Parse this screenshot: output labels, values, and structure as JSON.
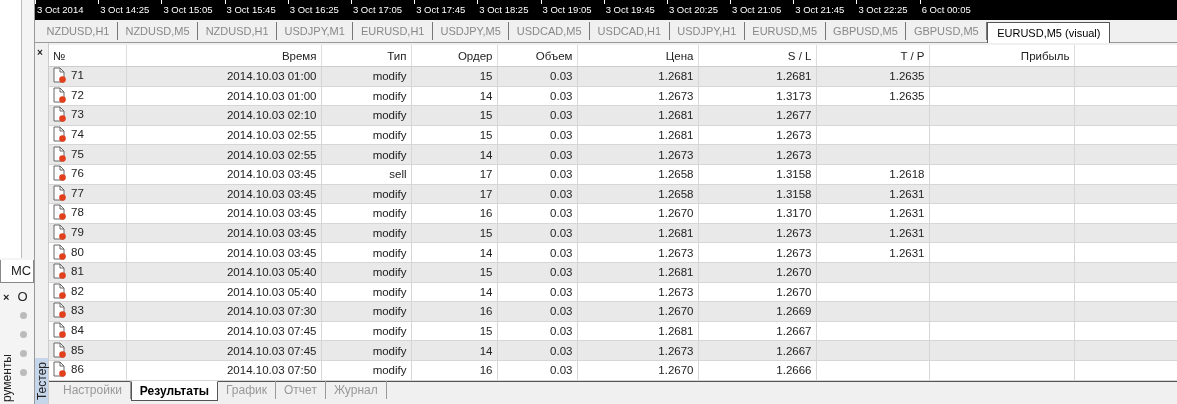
{
  "time_axis": [
    "3 Oct 2014",
    "3 Oct 14:25",
    "3 Oct 15:05",
    "3 Oct 15:45",
    "3 Oct 16:25",
    "3 Oct 17:05",
    "3 Oct 17:45",
    "3 Oct 18:25",
    "3 Oct 19:05",
    "3 Oct 19:45",
    "3 Oct 20:25",
    "3 Oct 21:05",
    "3 Oct 21:45",
    "3 Oct 22:25",
    "6 Oct 00:05"
  ],
  "chart_tabs": [
    {
      "label": "NZDUSD,H1",
      "selected": false
    },
    {
      "label": "NZDUSD,M5",
      "selected": false
    },
    {
      "label": "NZDUSD,H1",
      "selected": false
    },
    {
      "label": "USDJPY,M1",
      "selected": false
    },
    {
      "label": "EURUSD,H1",
      "selected": false
    },
    {
      "label": "USDJPY,M5",
      "selected": false
    },
    {
      "label": "USDCAD,M5",
      "selected": false
    },
    {
      "label": "USDCAD,H1",
      "selected": false
    },
    {
      "label": "USDJPY,H1",
      "selected": false
    },
    {
      "label": "EURUSD,M5",
      "selected": false
    },
    {
      "label": "GBPUSD,M5",
      "selected": false
    },
    {
      "label": "GBPUSD,M5",
      "selected": false
    },
    {
      "label": "EURUSD,M5 (visual)",
      "selected": true
    }
  ],
  "side_panel": {
    "tab": "MC",
    "close": "×",
    "header": "O",
    "title": "рументы"
  },
  "tester": {
    "close": "×",
    "title": "Тестер",
    "columns": [
      "№",
      "Время",
      "Тип",
      "Ордер",
      "Объем",
      "Цена",
      "S / L",
      "T / P",
      "Прибыль"
    ],
    "rows": [
      {
        "no": "71",
        "time": "2014.10.03 01:00",
        "type": "modify",
        "order": "15",
        "volume": "0.03",
        "price": "1.2681",
        "sl": "1.2681",
        "tp": "1.2635"
      },
      {
        "no": "72",
        "time": "2014.10.03 01:00",
        "type": "modify",
        "order": "14",
        "volume": "0.03",
        "price": "1.2673",
        "sl": "1.3173",
        "tp": "1.2635"
      },
      {
        "no": "73",
        "time": "2014.10.03 02:10",
        "type": "modify",
        "order": "15",
        "volume": "0.03",
        "price": "1.2681",
        "sl": "1.2677"
      },
      {
        "no": "74",
        "time": "2014.10.03 02:55",
        "type": "modify",
        "order": "15",
        "volume": "0.03",
        "price": "1.2681",
        "sl": "1.2673"
      },
      {
        "no": "75",
        "time": "2014.10.03 02:55",
        "type": "modify",
        "order": "14",
        "volume": "0.03",
        "price": "1.2673",
        "sl": "1.2673"
      },
      {
        "no": "76",
        "time": "2014.10.03 03:45",
        "type": "sell",
        "order": "17",
        "volume": "0.03",
        "price": "1.2658",
        "sl": "1.3158",
        "tp": "1.2618"
      },
      {
        "no": "77",
        "time": "2014.10.03 03:45",
        "type": "modify",
        "order": "17",
        "volume": "0.03",
        "price": "1.2658",
        "sl": "1.3158",
        "tp": "1.2631"
      },
      {
        "no": "78",
        "time": "2014.10.03 03:45",
        "type": "modify",
        "order": "16",
        "volume": "0.03",
        "price": "1.2670",
        "sl": "1.3170",
        "tp": "1.2631"
      },
      {
        "no": "79",
        "time": "2014.10.03 03:45",
        "type": "modify",
        "order": "15",
        "volume": "0.03",
        "price": "1.2681",
        "sl": "1.2673",
        "tp": "1.2631"
      },
      {
        "no": "80",
        "time": "2014.10.03 03:45",
        "type": "modify",
        "order": "14",
        "volume": "0.03",
        "price": "1.2673",
        "sl": "1.2673",
        "tp": "1.2631"
      },
      {
        "no": "81",
        "time": "2014.10.03 05:40",
        "type": "modify",
        "order": "15",
        "volume": "0.03",
        "price": "1.2681",
        "sl": "1.2670"
      },
      {
        "no": "82",
        "time": "2014.10.03 05:40",
        "type": "modify",
        "order": "14",
        "volume": "0.03",
        "price": "1.2673",
        "sl": "1.2670"
      },
      {
        "no": "83",
        "time": "2014.10.03 07:30",
        "type": "modify",
        "order": "16",
        "volume": "0.03",
        "price": "1.2670",
        "sl": "1.2669"
      },
      {
        "no": "84",
        "time": "2014.10.03 07:45",
        "type": "modify",
        "order": "15",
        "volume": "0.03",
        "price": "1.2681",
        "sl": "1.2667"
      },
      {
        "no": "85",
        "time": "2014.10.03 07:45",
        "type": "modify",
        "order": "14",
        "volume": "0.03",
        "price": "1.2673",
        "sl": "1.2667"
      },
      {
        "no": "86",
        "time": "2014.10.03 07:50",
        "type": "modify",
        "order": "16",
        "volume": "0.03",
        "price": "1.2670",
        "sl": "1.2666"
      }
    ],
    "tabs": [
      {
        "label": "Настройки",
        "selected": false
      },
      {
        "label": "Результаты",
        "selected": true
      },
      {
        "label": "График",
        "selected": false
      },
      {
        "label": "Отчет",
        "selected": false
      },
      {
        "label": "Журнал",
        "selected": false
      }
    ]
  }
}
